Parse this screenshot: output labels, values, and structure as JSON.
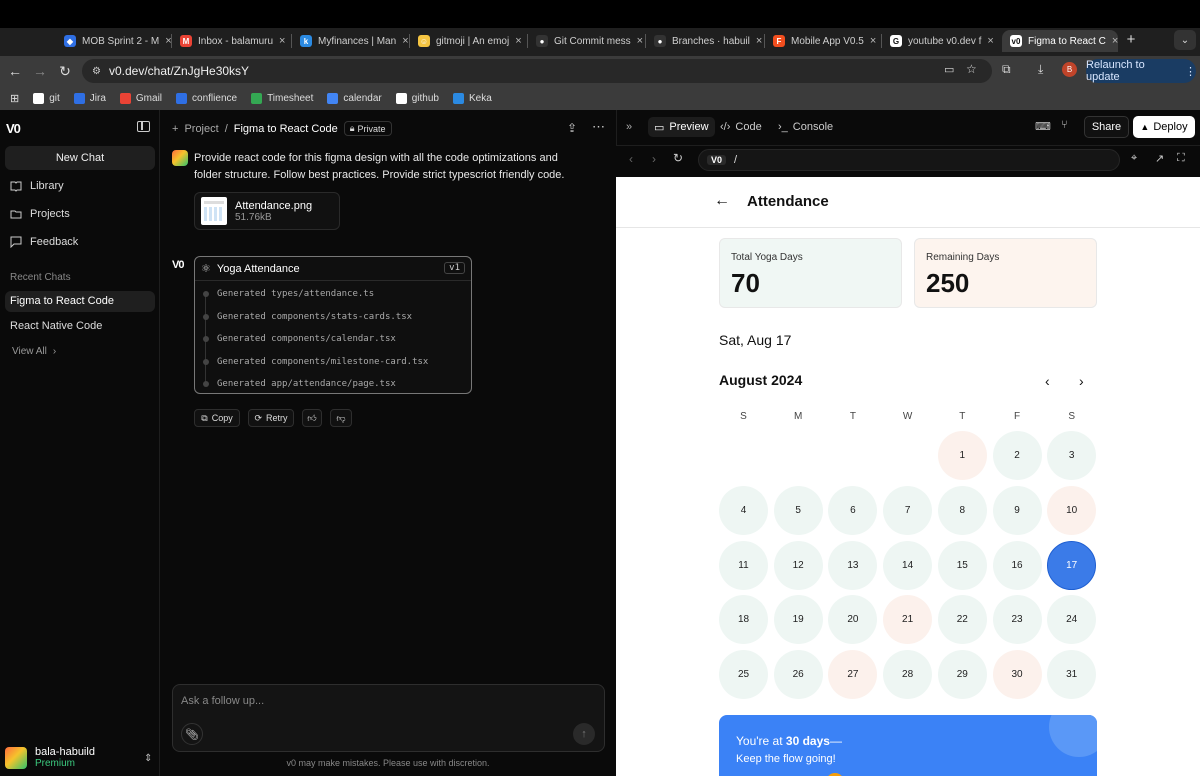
{
  "browser": {
    "tabs": [
      {
        "label": "MOB Sprint 2 - M",
        "icon": "jira-icon",
        "color": "#2f6fe4",
        "glyph": "◆"
      },
      {
        "label": "Inbox - balamuru",
        "icon": "gmail-icon",
        "color": "#ea4335",
        "glyph": "M"
      },
      {
        "label": "Myfinances | Man",
        "icon": "keka-icon",
        "color": "#2b8ae2",
        "glyph": "k"
      },
      {
        "label": "gitmoji | An emoj",
        "icon": "gitmoji-icon",
        "color": "#f5c542",
        "glyph": "☺"
      },
      {
        "label": "Git Commit mess",
        "icon": "github-icon",
        "color": "#333333",
        "glyph": "●"
      },
      {
        "label": "Branches · habuil",
        "icon": "github-icon",
        "color": "#333333",
        "glyph": "●"
      },
      {
        "label": "Mobile App V0.5",
        "icon": "figma-icon",
        "color": "#f24e1e",
        "glyph": "F"
      },
      {
        "label": "youtube v0.dev f",
        "icon": "google-icon",
        "color": "#ffffff",
        "glyph": "G"
      },
      {
        "label": "Figma to React C",
        "icon": "v0-icon",
        "color": "#ffffff",
        "glyph": "v0"
      }
    ],
    "url": "v0.dev/chat/ZnJgHe30ksY",
    "profile_initial": "B",
    "relaunch_label": "Relaunch to update",
    "bookmarks": [
      {
        "label": "git",
        "color": "#ffffff"
      },
      {
        "label": "Jira",
        "color": "#2f6fe4"
      },
      {
        "label": "Gmail",
        "color": "#ea4335"
      },
      {
        "label": "conflience",
        "color": "#2f6fe4"
      },
      {
        "label": "Timesheet",
        "color": "#34a853"
      },
      {
        "label": "calendar",
        "color": "#4285f4"
      },
      {
        "label": "github",
        "color": "#ffffff"
      },
      {
        "label": "Keka",
        "color": "#2b8ae2"
      }
    ]
  },
  "sidebar": {
    "logo": "V0",
    "new_chat": "New Chat",
    "nav": [
      {
        "label": "Library"
      },
      {
        "label": "Projects"
      },
      {
        "label": "Feedback"
      }
    ],
    "recent_heading": "Recent Chats",
    "recent": [
      {
        "label": "Figma to React Code"
      },
      {
        "label": "React Native Code"
      }
    ],
    "view_all": "View All",
    "user": {
      "name": "bala-habuild",
      "plan": "Premium"
    }
  },
  "chat": {
    "breadcrumb": {
      "project": "Project",
      "separator": "/",
      "title": "Figma to React Code",
      "badge": "Private"
    },
    "user_message": "Provide react code for this figma design with all the code optimizations and folder structure. Follow best practices. Provide strict typescriot friendly code.",
    "attachment": {
      "name": "Attendance.png",
      "size": "51.76kB"
    },
    "assistant_logo": "V0",
    "card": {
      "title": "Yoga Attendance",
      "version": "v1",
      "steps": [
        "Generated types/attendance.ts",
        "Generated components/stats-cards.tsx",
        "Generated components/calendar.tsx",
        "Generated components/milestone-card.tsx",
        "Generated app/attendance/page.tsx"
      ]
    },
    "actions": {
      "copy": "Copy",
      "retry": "Retry"
    },
    "input_placeholder": "Ask a follow up...",
    "disclaimer": "v0 may make mistakes. Please use with discretion."
  },
  "preview": {
    "tabs": {
      "preview": "Preview",
      "code": "Code",
      "console": "Console"
    },
    "share": "Share",
    "deploy": "Deploy",
    "path": "/",
    "app": {
      "title": "Attendance",
      "stats": [
        {
          "label": "Total Yoga Days",
          "value": "70",
          "color": "#f0f7f4"
        },
        {
          "label": "Remaining Days",
          "value": "250",
          "color": "#fdf4ee"
        }
      ],
      "selected_date": "Sat, Aug 17",
      "month": "August 2024",
      "weekdays": [
        "S",
        "M",
        "T",
        "W",
        "T",
        "F",
        "S"
      ],
      "first_weekday": 4,
      "days_in_month": 31,
      "today": 17,
      "absent_days": [
        1,
        10,
        21,
        27,
        30
      ],
      "milestone": {
        "prefix": "You're at ",
        "days": "30 days",
        "suffix": "—",
        "line2": "Keep the flow going!"
      }
    }
  }
}
